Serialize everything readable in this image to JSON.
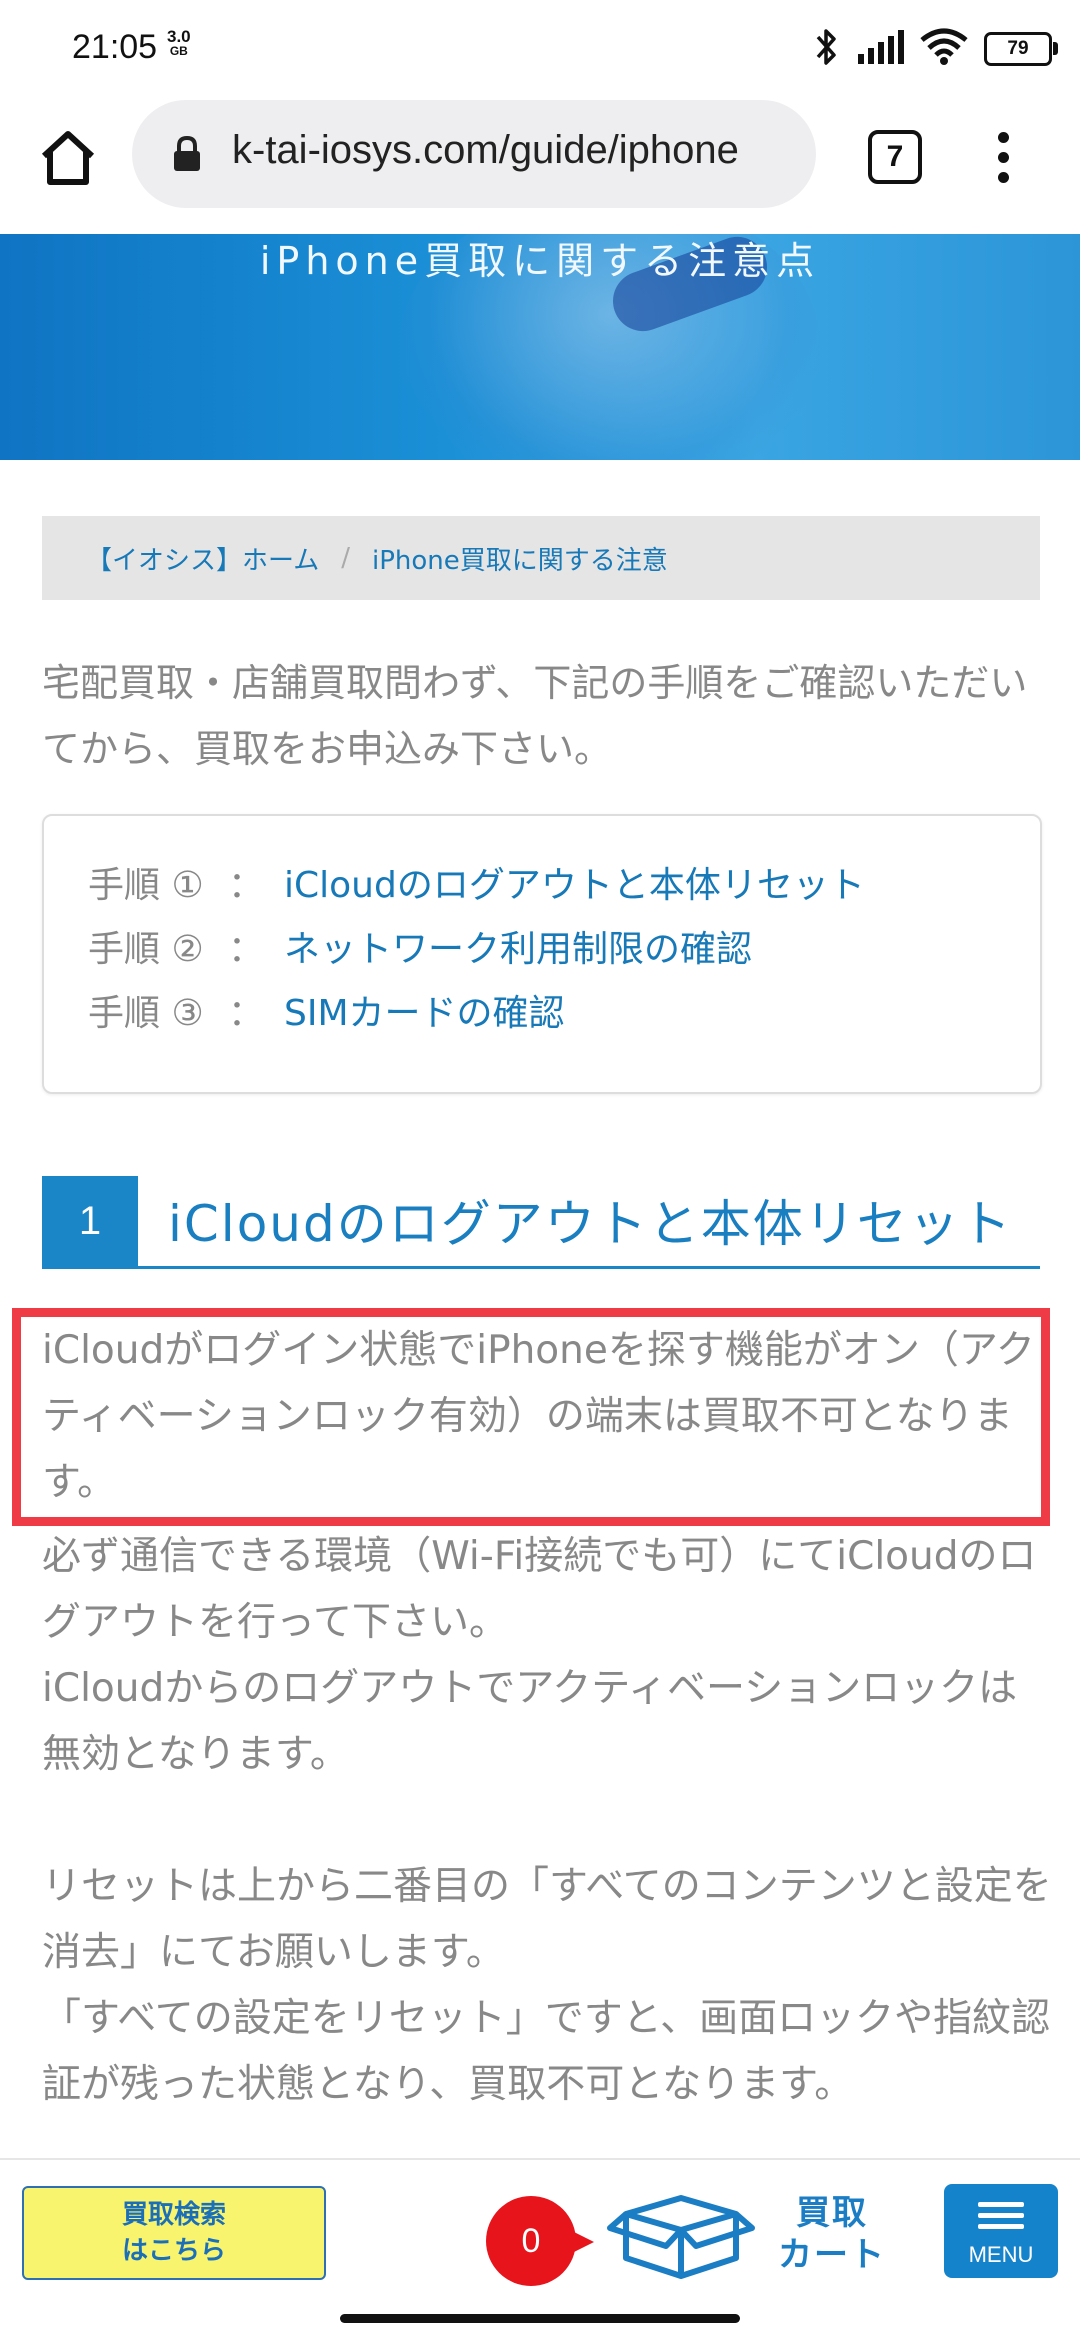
{
  "status": {
    "time": "21:05",
    "data_speed": "3.0",
    "data_unit": "GB",
    "battery": "79",
    "icons": [
      "bluetooth-icon",
      "signal-icon",
      "wifi-icon",
      "battery-icon"
    ]
  },
  "browser": {
    "url": "k-tai-iosys.com/guide/iphone",
    "tab_count": "7"
  },
  "hero": {
    "title": "iPhone買取に関する注意点"
  },
  "breadcrumb": {
    "home": "【イオシス】ホーム",
    "separator": "/",
    "current": "iPhone買取に関する注意"
  },
  "intro": "宅配買取・店舗買取問わず、下記の手順をご確認いただいてから、買取をお申込み下さい。",
  "steps": [
    {
      "label": "手順 ①",
      "colon": "：",
      "link": "iCloudのログアウトと本体リセット"
    },
    {
      "label": "手順 ②",
      "colon": "：",
      "link": "ネットワーク利用制限の確認"
    },
    {
      "label": "手順 ③",
      "colon": "：",
      "link": "SIMカードの確認"
    }
  ],
  "section1": {
    "number": "1",
    "title": "iCloudのログアウトと本体リセット",
    "warning": "iCloudがログイン状態でiPhoneを探す機能がオン（アクティベーションロック有効）の端末は買取不可となります。",
    "paragraphs": [
      "必ず通信できる環境（Wi-Fi接続でも可）にてiCloudのログアウトを行って下さい。",
      "iCloudからのログアウトでアクティベーションロックは無効となります。",
      "リセットは上から二番目の「すべてのコンテンツと設定を消去」にてお願いします。",
      "「すべての設定をリセット」ですと、画面ロックや指紋認証が残った状態となり、買取不可となります。"
    ]
  },
  "bottom": {
    "search_line1": "買取検索",
    "search_line2": "はこちら",
    "cart_count": "0",
    "cart_line1": "買取",
    "cart_line2": "カート",
    "menu": "MENU"
  },
  "colors": {
    "accent": "#1a86c8",
    "link": "#1779b8",
    "highlight_border": "#ef3b45",
    "search_button": "#f8f46e",
    "cart_badge": "#e8141c"
  }
}
